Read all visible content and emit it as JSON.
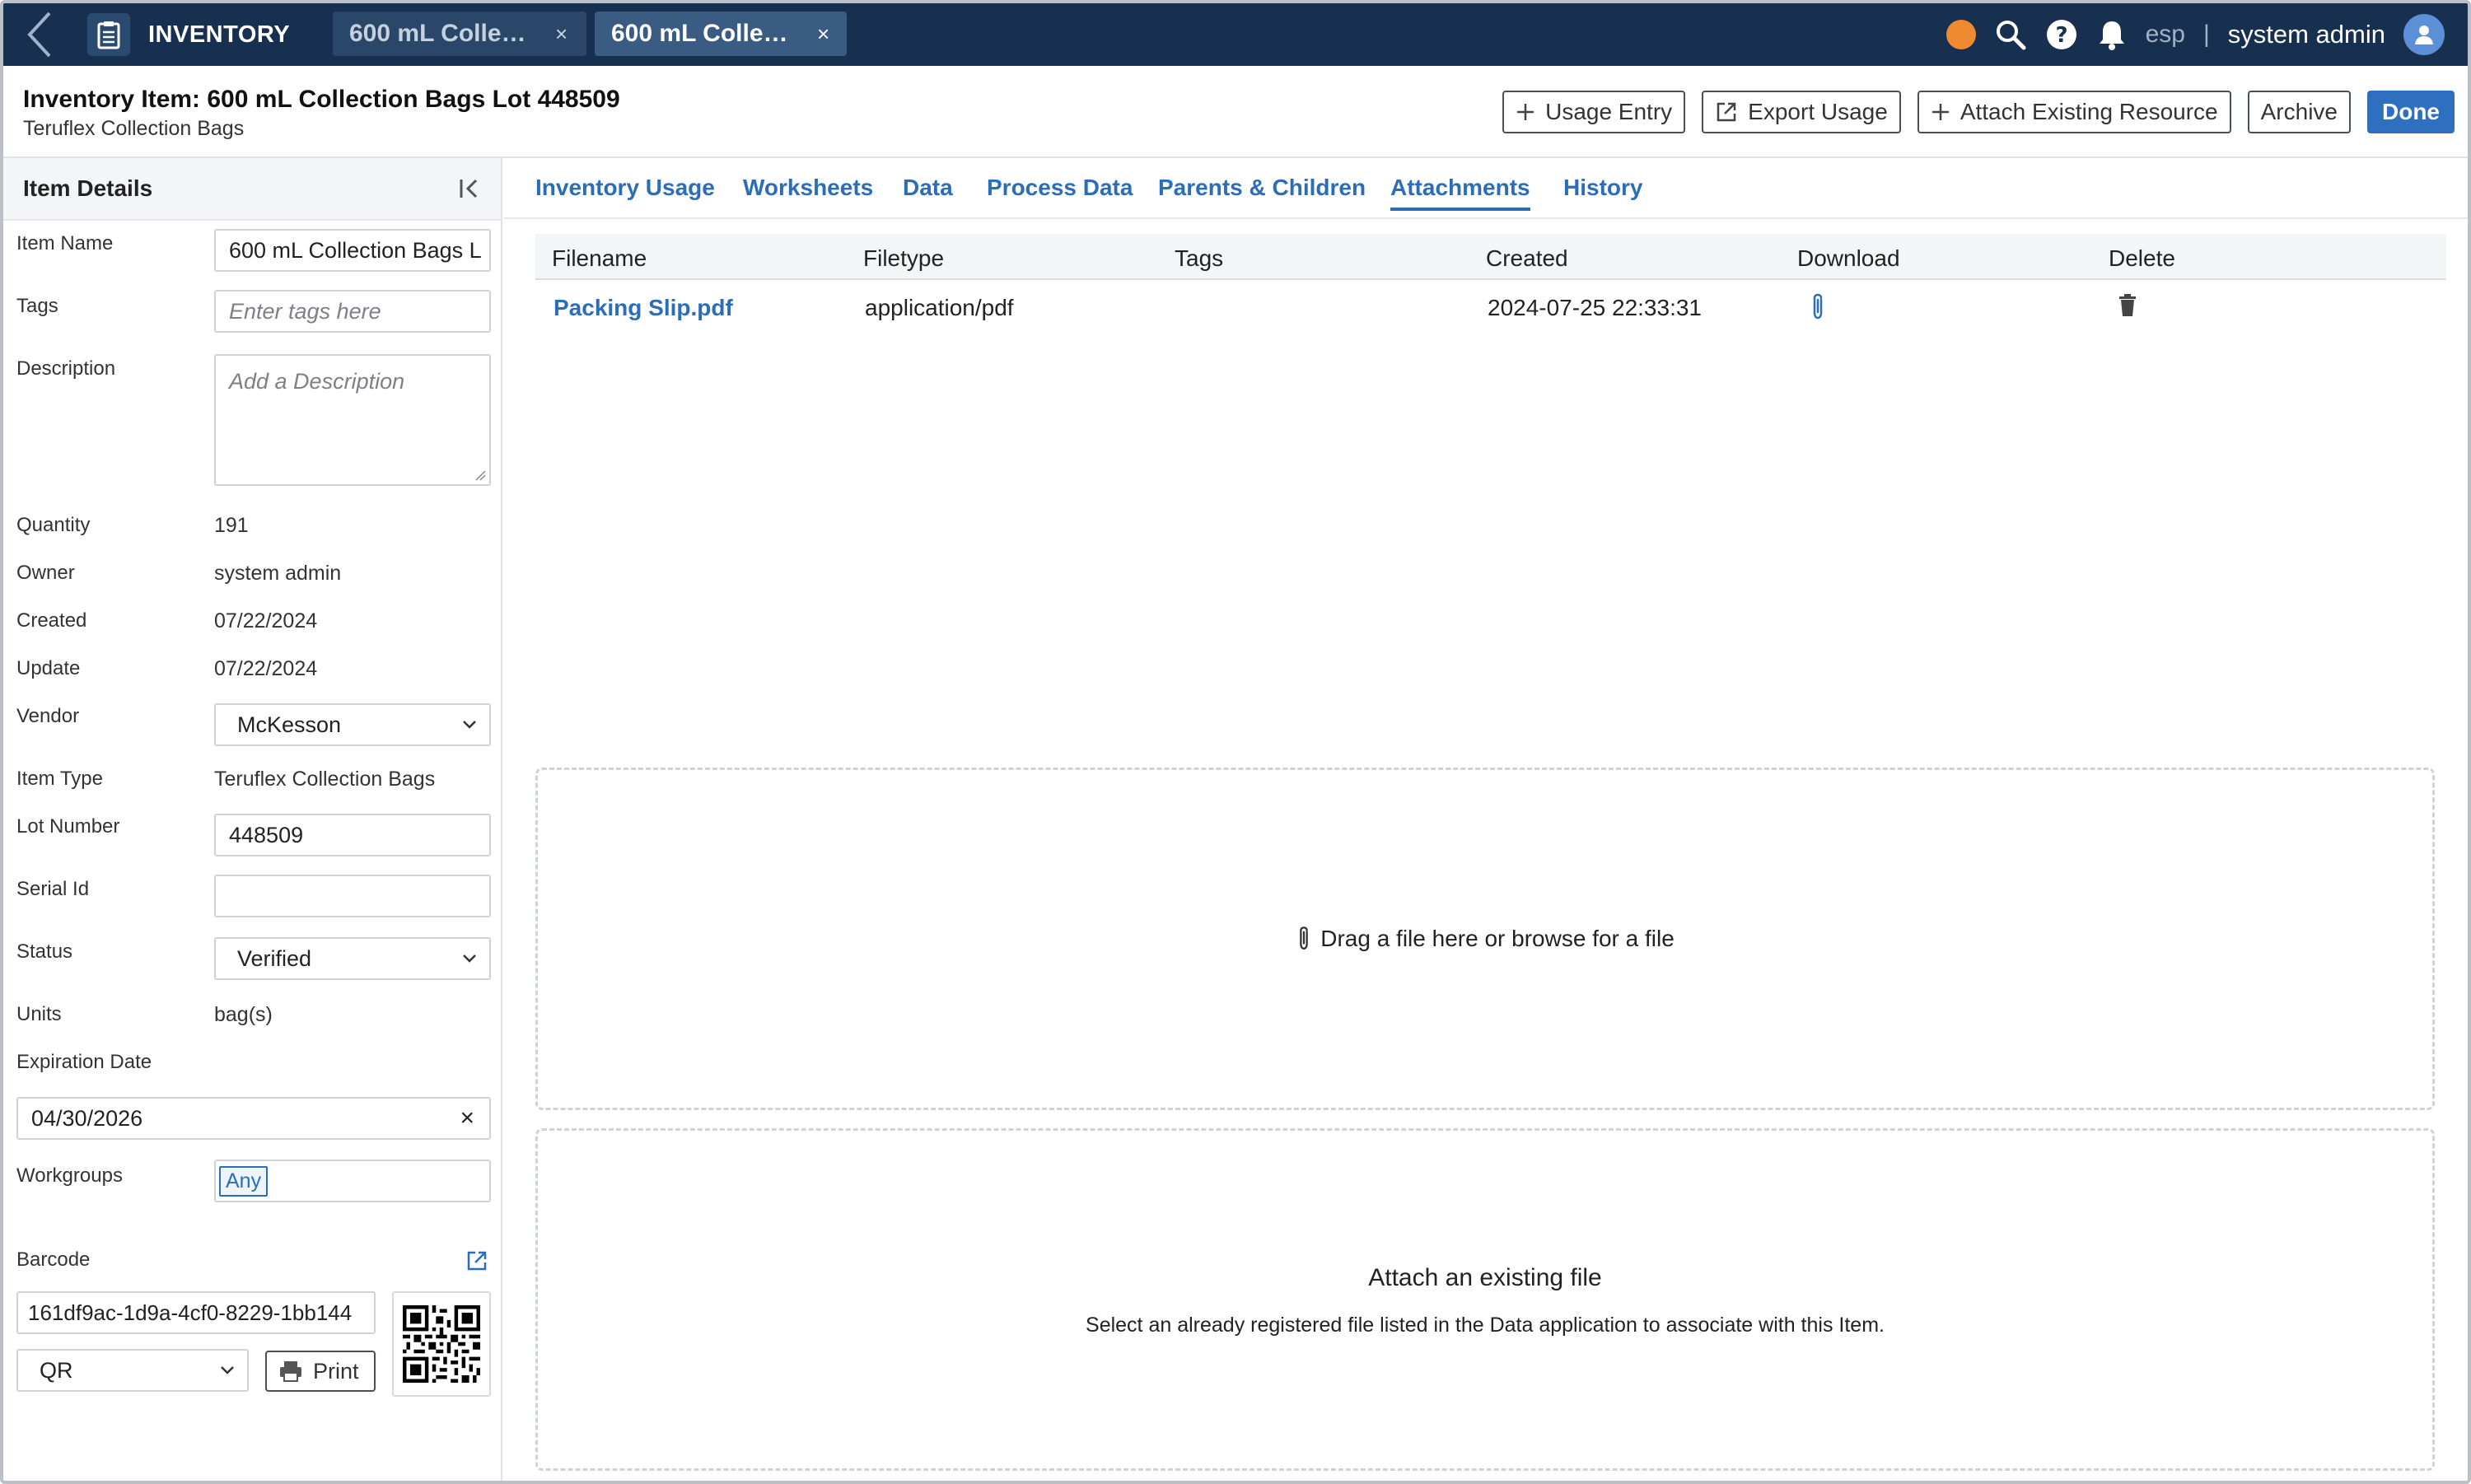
{
  "app": {
    "title": "INVENTORY",
    "tabs": [
      {
        "label": "600 mL Collecti...",
        "close": "×"
      },
      {
        "label": "600 mL Collecti...",
        "close": "×"
      }
    ],
    "language": "esp",
    "separator": "|",
    "user_name": "system admin",
    "status_color": "#f08a30"
  },
  "header": {
    "title": "Inventory Item: 600 mL Collection Bags Lot 448509",
    "subtitle": "Teruflex Collection Bags",
    "actions": {
      "usage_entry": "Usage Entry",
      "export_usage": "Export Usage",
      "attach_existing": "Attach Existing Resource",
      "archive": "Archive",
      "done": "Done"
    }
  },
  "details": {
    "panel_title": "Item Details",
    "item_name_label": "Item Name",
    "item_name_value": "600 mL Collection Bags L",
    "tags_label": "Tags",
    "tags_placeholder": "Enter tags here",
    "description_label": "Description",
    "description_placeholder": "Add a Description",
    "quantity_label": "Quantity",
    "quantity_value": "191",
    "owner_label": "Owner",
    "owner_value": "system admin",
    "created_label": "Created",
    "created_value": "07/22/2024",
    "update_label": "Update",
    "update_value": "07/22/2024",
    "vendor_label": "Vendor",
    "vendor_value": "McKesson",
    "item_type_label": "Item Type",
    "item_type_value": "Teruflex Collection Bags",
    "lot_number_label": "Lot Number",
    "lot_number_value": "448509",
    "serial_id_label": "Serial Id",
    "serial_id_value": "",
    "status_label": "Status",
    "status_value": "Verified",
    "units_label": "Units",
    "units_value": "bag(s)",
    "expiration_label": "Expiration Date",
    "expiration_value": "04/30/2026",
    "expiration_clear": "×",
    "workgroups_label": "Workgroups",
    "workgroups_value": "Any",
    "barcode_label": "Barcode",
    "barcode_value": "161df9ac-1d9a-4cf0-8229-1bb144",
    "barcode_type": "QR",
    "print_label": "Print"
  },
  "main": {
    "tabs": [
      "Inventory Usage",
      "Worksheets",
      "Data",
      "Process Data",
      "Parents & Children",
      "Attachments",
      "History"
    ],
    "active_tab": "Attachments",
    "table": {
      "headers": [
        "Filename",
        "Filetype",
        "Tags",
        "Created",
        "Download",
        "Delete"
      ],
      "rows": [
        {
          "filename": "Packing Slip.pdf",
          "filetype": "application/pdf",
          "tags": "",
          "created": "2024-07-25 22:33:31"
        }
      ]
    },
    "dropzone_text": "Drag a file here or browse for a file",
    "attach_title": "Attach an existing file",
    "attach_desc": "Select an already registered file listed in the Data application to associate with this Item."
  }
}
